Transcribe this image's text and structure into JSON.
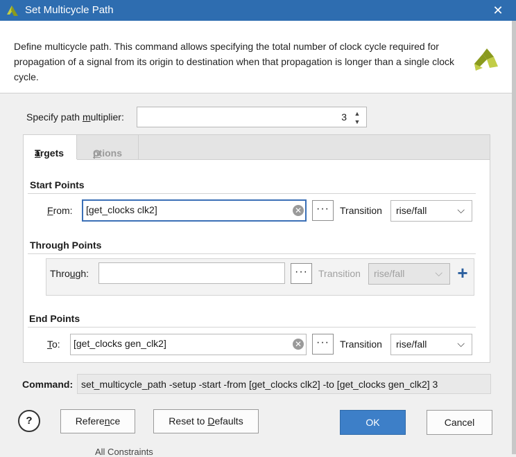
{
  "window": {
    "title": "Set Multicycle Path",
    "close_glyph": "✕"
  },
  "description": "Define multicycle path. This command allows specifying the total number of clock cycle required for propagation of a signal from its origin to destination when that propagation is longer than a single clock cycle.",
  "multiplier": {
    "label_pre": "Specify path ",
    "label_u": "m",
    "label_post": "ultiplier:",
    "value": "3"
  },
  "tabs": [
    {
      "label_u": "T",
      "label_rest": "argets"
    },
    {
      "label_u": "O",
      "label_rest": "ptions"
    }
  ],
  "start_points": {
    "title": "Start Points",
    "from_label_u": "F",
    "from_label_rest": "rom:",
    "value": "[get_clocks clk2]",
    "transition_label": "Transition",
    "transition_value": "rise/fall"
  },
  "through_points": {
    "title": "Through Points",
    "label_pre": "Thro",
    "label_u": "u",
    "label_post": "gh:",
    "value": "",
    "transition_label": "Transition",
    "transition_value": "rise/fall"
  },
  "end_points": {
    "title": "End Points",
    "to_label_u": "T",
    "to_label_rest": "o:",
    "value": "[get_clocks gen_clk2]",
    "transition_label": "Transition",
    "transition_value": "rise/fall"
  },
  "command": {
    "label": "Command:",
    "value": "set_multicycle_path -setup -start -from [get_clocks clk2] -to [get_clocks gen_clk2] 3"
  },
  "buttons": {
    "help": "?",
    "reference_pre": "Refere",
    "reference_u": "n",
    "reference_post": "ce",
    "reset_pre": "Reset to ",
    "reset_u": "D",
    "reset_post": "efaults",
    "ok": "OK",
    "cancel": "Cancel"
  },
  "icons": {
    "dots": "···",
    "plus": "+",
    "chevron": "⌵",
    "clear": "✕",
    "spin_up": "▲",
    "spin_down": "▼"
  },
  "colors": {
    "titlebar": "#2e6db0",
    "primary_button": "#3d7fc8",
    "logo_dark": "#8a9a1e",
    "logo_light": "#c2cd47"
  },
  "background_peek": "All Constraints"
}
